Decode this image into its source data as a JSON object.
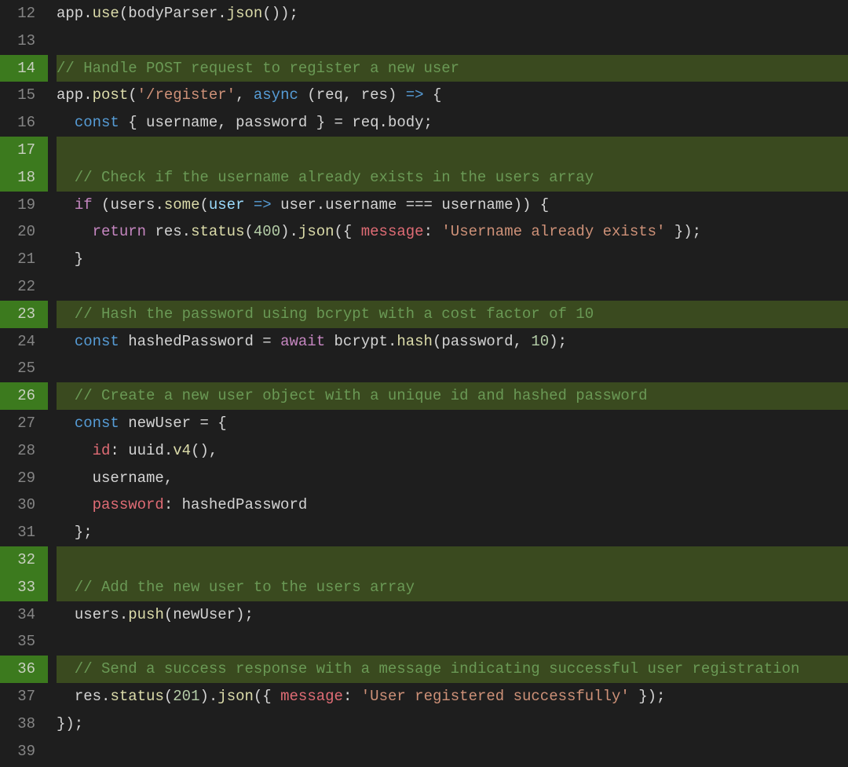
{
  "lines": [
    {
      "num": 12,
      "hl": false,
      "tokens": [
        {
          "t": "app",
          "c": "tk-default"
        },
        {
          "t": ".",
          "c": "tk-punct"
        },
        {
          "t": "use",
          "c": "tk-call"
        },
        {
          "t": "(",
          "c": "tk-punct"
        },
        {
          "t": "bodyParser",
          "c": "tk-default"
        },
        {
          "t": ".",
          "c": "tk-punct"
        },
        {
          "t": "json",
          "c": "tk-call"
        },
        {
          "t": "());",
          "c": "tk-punct"
        }
      ]
    },
    {
      "num": 13,
      "hl": false,
      "tokens": [
        {
          "t": "",
          "c": "tk-default"
        }
      ]
    },
    {
      "num": 14,
      "hl": true,
      "tokens": [
        {
          "t": "// Handle POST request to register a new user",
          "c": "tk-comment"
        }
      ]
    },
    {
      "num": 15,
      "hl": false,
      "tokens": [
        {
          "t": "app",
          "c": "tk-default"
        },
        {
          "t": ".",
          "c": "tk-punct"
        },
        {
          "t": "post",
          "c": "tk-call"
        },
        {
          "t": "(",
          "c": "tk-punct"
        },
        {
          "t": "'/register'",
          "c": "tk-string"
        },
        {
          "t": ", ",
          "c": "tk-punct"
        },
        {
          "t": "async",
          "c": "tk-keyword"
        },
        {
          "t": " (",
          "c": "tk-punct"
        },
        {
          "t": "req",
          "c": "tk-default"
        },
        {
          "t": ", ",
          "c": "tk-punct"
        },
        {
          "t": "res",
          "c": "tk-default"
        },
        {
          "t": ") ",
          "c": "tk-punct"
        },
        {
          "t": "=>",
          "c": "tk-keyword"
        },
        {
          "t": " {",
          "c": "tk-punct"
        }
      ]
    },
    {
      "num": 16,
      "hl": false,
      "tokens": [
        {
          "t": "  ",
          "c": "tk-default"
        },
        {
          "t": "const",
          "c": "tk-keyword"
        },
        {
          "t": " { ",
          "c": "tk-punct"
        },
        {
          "t": "username",
          "c": "tk-default"
        },
        {
          "t": ", ",
          "c": "tk-punct"
        },
        {
          "t": "password",
          "c": "tk-default"
        },
        {
          "t": " } = ",
          "c": "tk-punct"
        },
        {
          "t": "req",
          "c": "tk-default"
        },
        {
          "t": ".",
          "c": "tk-punct"
        },
        {
          "t": "body",
          "c": "tk-prop"
        },
        {
          "t": ";",
          "c": "tk-punct"
        }
      ]
    },
    {
      "num": 17,
      "hl": true,
      "tokens": [
        {
          "t": "",
          "c": "tk-default"
        }
      ]
    },
    {
      "num": 18,
      "hl": true,
      "tokens": [
        {
          "t": "  // Check if the username already exists in the users array",
          "c": "tk-comment"
        }
      ]
    },
    {
      "num": 19,
      "hl": false,
      "tokens": [
        {
          "t": "  ",
          "c": "tk-default"
        },
        {
          "t": "if",
          "c": "tk-keyword2"
        },
        {
          "t": " (",
          "c": "tk-punct"
        },
        {
          "t": "users",
          "c": "tk-default"
        },
        {
          "t": ".",
          "c": "tk-punct"
        },
        {
          "t": "some",
          "c": "tk-call"
        },
        {
          "t": "(",
          "c": "tk-punct"
        },
        {
          "t": "user",
          "c": "tk-param"
        },
        {
          "t": " ",
          "c": "tk-default"
        },
        {
          "t": "=>",
          "c": "tk-keyword"
        },
        {
          "t": " ",
          "c": "tk-default"
        },
        {
          "t": "user",
          "c": "tk-default"
        },
        {
          "t": ".",
          "c": "tk-punct"
        },
        {
          "t": "username",
          "c": "tk-prop"
        },
        {
          "t": " === ",
          "c": "tk-punct"
        },
        {
          "t": "username",
          "c": "tk-default"
        },
        {
          "t": ")) {",
          "c": "tk-punct"
        }
      ]
    },
    {
      "num": 20,
      "hl": false,
      "tokens": [
        {
          "t": "    ",
          "c": "tk-default"
        },
        {
          "t": "return",
          "c": "tk-keyword2"
        },
        {
          "t": " ",
          "c": "tk-default"
        },
        {
          "t": "res",
          "c": "tk-default"
        },
        {
          "t": ".",
          "c": "tk-punct"
        },
        {
          "t": "status",
          "c": "tk-call"
        },
        {
          "t": "(",
          "c": "tk-punct"
        },
        {
          "t": "400",
          "c": "tk-number"
        },
        {
          "t": ").",
          "c": "tk-punct"
        },
        {
          "t": "json",
          "c": "tk-call"
        },
        {
          "t": "({ ",
          "c": "tk-punct"
        },
        {
          "t": "message",
          "c": "tk-objkey"
        },
        {
          "t": ": ",
          "c": "tk-punct"
        },
        {
          "t": "'Username already exists'",
          "c": "tk-string"
        },
        {
          "t": " });",
          "c": "tk-punct"
        }
      ]
    },
    {
      "num": 21,
      "hl": false,
      "tokens": [
        {
          "t": "  }",
          "c": "tk-punct"
        }
      ]
    },
    {
      "num": 22,
      "hl": false,
      "tokens": [
        {
          "t": "",
          "c": "tk-default"
        }
      ]
    },
    {
      "num": 23,
      "hl": true,
      "tokens": [
        {
          "t": "  // Hash the password using bcrypt with a cost factor of 10",
          "c": "tk-comment"
        }
      ]
    },
    {
      "num": 24,
      "hl": false,
      "tokens": [
        {
          "t": "  ",
          "c": "tk-default"
        },
        {
          "t": "const",
          "c": "tk-keyword"
        },
        {
          "t": " ",
          "c": "tk-default"
        },
        {
          "t": "hashedPassword",
          "c": "tk-default"
        },
        {
          "t": " = ",
          "c": "tk-punct"
        },
        {
          "t": "await",
          "c": "tk-keyword2"
        },
        {
          "t": " ",
          "c": "tk-default"
        },
        {
          "t": "bcrypt",
          "c": "tk-default"
        },
        {
          "t": ".",
          "c": "tk-punct"
        },
        {
          "t": "hash",
          "c": "tk-call"
        },
        {
          "t": "(",
          "c": "tk-punct"
        },
        {
          "t": "password",
          "c": "tk-default"
        },
        {
          "t": ", ",
          "c": "tk-punct"
        },
        {
          "t": "10",
          "c": "tk-number"
        },
        {
          "t": ");",
          "c": "tk-punct"
        }
      ]
    },
    {
      "num": 25,
      "hl": false,
      "tokens": [
        {
          "t": "",
          "c": "tk-default"
        }
      ]
    },
    {
      "num": 26,
      "hl": true,
      "tokens": [
        {
          "t": "  // Create a new user object with a unique id and hashed password",
          "c": "tk-comment"
        }
      ]
    },
    {
      "num": 27,
      "hl": false,
      "tokens": [
        {
          "t": "  ",
          "c": "tk-default"
        },
        {
          "t": "const",
          "c": "tk-keyword"
        },
        {
          "t": " ",
          "c": "tk-default"
        },
        {
          "t": "newUser",
          "c": "tk-default"
        },
        {
          "t": " = {",
          "c": "tk-punct"
        }
      ]
    },
    {
      "num": 28,
      "hl": false,
      "tokens": [
        {
          "t": "    ",
          "c": "tk-default"
        },
        {
          "t": "id",
          "c": "tk-objkey"
        },
        {
          "t": ": ",
          "c": "tk-punct"
        },
        {
          "t": "uuid",
          "c": "tk-default"
        },
        {
          "t": ".",
          "c": "tk-punct"
        },
        {
          "t": "v4",
          "c": "tk-call"
        },
        {
          "t": "(),",
          "c": "tk-punct"
        }
      ]
    },
    {
      "num": 29,
      "hl": false,
      "tokens": [
        {
          "t": "    ",
          "c": "tk-default"
        },
        {
          "t": "username",
          "c": "tk-default"
        },
        {
          "t": ",",
          "c": "tk-punct"
        }
      ]
    },
    {
      "num": 30,
      "hl": false,
      "tokens": [
        {
          "t": "    ",
          "c": "tk-default"
        },
        {
          "t": "password",
          "c": "tk-objkey"
        },
        {
          "t": ": ",
          "c": "tk-punct"
        },
        {
          "t": "hashedPassword",
          "c": "tk-default"
        }
      ]
    },
    {
      "num": 31,
      "hl": false,
      "tokens": [
        {
          "t": "  };",
          "c": "tk-punct"
        }
      ]
    },
    {
      "num": 32,
      "hl": true,
      "tokens": [
        {
          "t": "",
          "c": "tk-default"
        }
      ]
    },
    {
      "num": 33,
      "hl": true,
      "tokens": [
        {
          "t": "  // Add the new user to the users array",
          "c": "tk-comment"
        }
      ]
    },
    {
      "num": 34,
      "hl": false,
      "tokens": [
        {
          "t": "  ",
          "c": "tk-default"
        },
        {
          "t": "users",
          "c": "tk-default"
        },
        {
          "t": ".",
          "c": "tk-punct"
        },
        {
          "t": "push",
          "c": "tk-call"
        },
        {
          "t": "(",
          "c": "tk-punct"
        },
        {
          "t": "newUser",
          "c": "tk-default"
        },
        {
          "t": ");",
          "c": "tk-punct"
        }
      ]
    },
    {
      "num": 35,
      "hl": false,
      "tokens": [
        {
          "t": "",
          "c": "tk-default"
        }
      ]
    },
    {
      "num": 36,
      "hl": true,
      "tokens": [
        {
          "t": "  // Send a success response with a message indicating successful user registration",
          "c": "tk-comment"
        }
      ]
    },
    {
      "num": 37,
      "hl": false,
      "tokens": [
        {
          "t": "  ",
          "c": "tk-default"
        },
        {
          "t": "res",
          "c": "tk-default"
        },
        {
          "t": ".",
          "c": "tk-punct"
        },
        {
          "t": "status",
          "c": "tk-call"
        },
        {
          "t": "(",
          "c": "tk-punct"
        },
        {
          "t": "201",
          "c": "tk-number"
        },
        {
          "t": ").",
          "c": "tk-punct"
        },
        {
          "t": "json",
          "c": "tk-call"
        },
        {
          "t": "({ ",
          "c": "tk-punct"
        },
        {
          "t": "message",
          "c": "tk-objkey"
        },
        {
          "t": ": ",
          "c": "tk-punct"
        },
        {
          "t": "'User registered successfully'",
          "c": "tk-string"
        },
        {
          "t": " });",
          "c": "tk-punct"
        }
      ]
    },
    {
      "num": 38,
      "hl": false,
      "tokens": [
        {
          "t": "});",
          "c": "tk-punct"
        }
      ]
    },
    {
      "num": 39,
      "hl": false,
      "tokens": [
        {
          "t": "",
          "c": "tk-default"
        }
      ]
    }
  ]
}
